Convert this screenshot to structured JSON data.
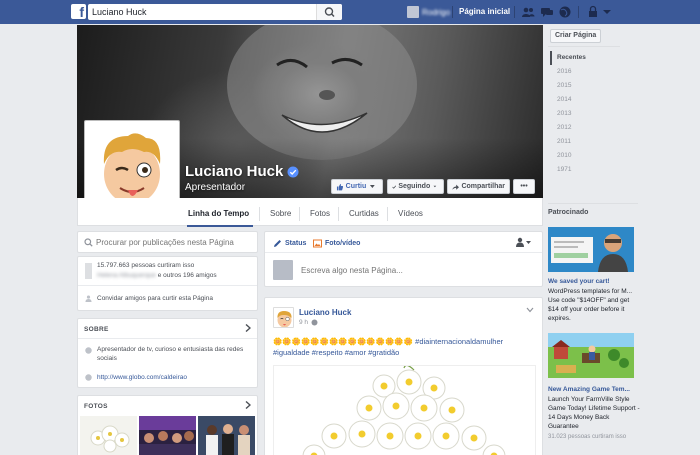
{
  "topbar": {
    "logo": "f",
    "search_value": "Luciano Huck",
    "user_name": "Rodrigo",
    "home_label": "Página inicial",
    "icons": [
      "friends-icon",
      "messages-icon",
      "globe-icon",
      "settings-icon"
    ]
  },
  "page": {
    "name": "Luciano Huck",
    "category": "Apresentador",
    "buttons": {
      "like": "Curtiu",
      "following": "Seguindo",
      "share": "Compartilhar",
      "more": "•••"
    }
  },
  "tabs": [
    "Linha do Tempo",
    "Sobre",
    "Fotos",
    "Curtidas",
    "Vídeos"
  ],
  "left": {
    "search_placeholder": "Procurar por publicações nesta Página",
    "likes_count": "15.797.663 pessoas curtiram isso",
    "friends_names": "Helena Albuquerque",
    "friends_suffix": " e outros 196 amigos",
    "invite_label": "Convidar amigos para curtir esta Página",
    "about_title": "SOBRE",
    "about_text": "Apresentador de tv, curioso e entusiasta das redes sociais",
    "about_link": "http://www.globo.com/caldeirao",
    "photos_title": "FOTOS"
  },
  "composer": {
    "status_label": "Status",
    "photo_label": "Foto/vídeo",
    "placeholder": "Escreva algo nesta Página..."
  },
  "post": {
    "author": "Luciano Huck",
    "time": "9 h",
    "text": "🌼🌼🌼🌼🌼🌼🌼🌼🌼🌼🌼🌼🌼🌼🌼 #diainternacionaldamulher #igualdade #respeito #amor #gratidão"
  },
  "right": {
    "create_page": "Criar Página",
    "years": [
      "Recentes",
      "2016",
      "2015",
      "2014",
      "2013",
      "2012",
      "2011",
      "2010",
      "1971"
    ],
    "sponsored": "Patrocinado",
    "ads": [
      {
        "title": "We saved your cart!",
        "desc": "WordPress templates for M... Use code \"$14OFF\" and get $14 off your order before it expires."
      },
      {
        "title": "New Amazing Game Tem...",
        "desc": "Launch Your FarmVille Style Game Today! Lifetime Support - 14 Days Money Back Guarantee"
      }
    ],
    "ad_likes": "31.023 pessoas curtiram isso"
  },
  "colors": {
    "brand": "#3b5998",
    "link": "#365899",
    "background": "#e9ebee"
  }
}
